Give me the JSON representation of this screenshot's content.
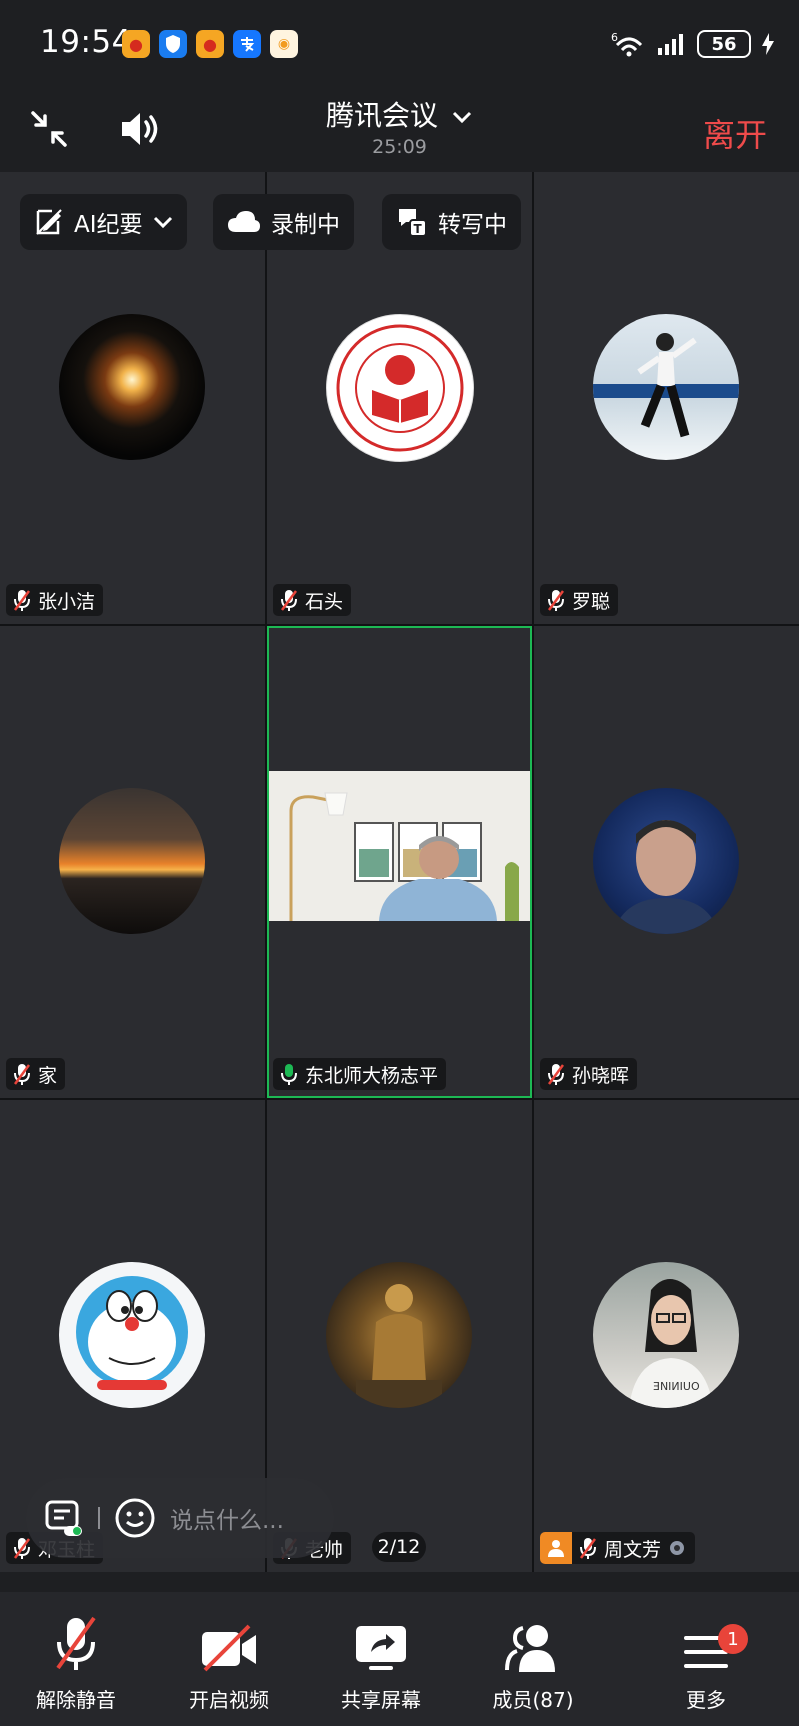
{
  "status_bar": {
    "time": "19:54",
    "battery": "56",
    "network": "6"
  },
  "header": {
    "title": "腾讯会议",
    "duration": "25:09",
    "leave_label": "离开"
  },
  "toolbar_pills": {
    "ai": "AI纪要",
    "record": "录制中",
    "transcribe": "转写中"
  },
  "participants": [
    {
      "name": "张小洁",
      "muted": true
    },
    {
      "name": "石头",
      "muted": true
    },
    {
      "name": "罗聪",
      "muted": true
    },
    {
      "name": "家",
      "muted": true
    },
    {
      "name": "东北师大杨志平",
      "muted": false,
      "speaking": true
    },
    {
      "name": "孙晓晖",
      "muted": true
    },
    {
      "name": "邓玉柱",
      "muted": true
    },
    {
      "name": "老帅",
      "muted": true
    },
    {
      "name": "周文芳",
      "muted": true,
      "host": true
    }
  ],
  "chat": {
    "placeholder": "说点什么..."
  },
  "pager": "2/12",
  "bottom_bar": {
    "unmute": "解除静音",
    "video": "开启视频",
    "share": "共享屏幕",
    "members": "成员(87)",
    "more": "更多",
    "more_badge": "1"
  },
  "colors": {
    "accent_green": "#1db954",
    "leave_red": "#ef4b4b",
    "mute_red": "#e8443a"
  }
}
